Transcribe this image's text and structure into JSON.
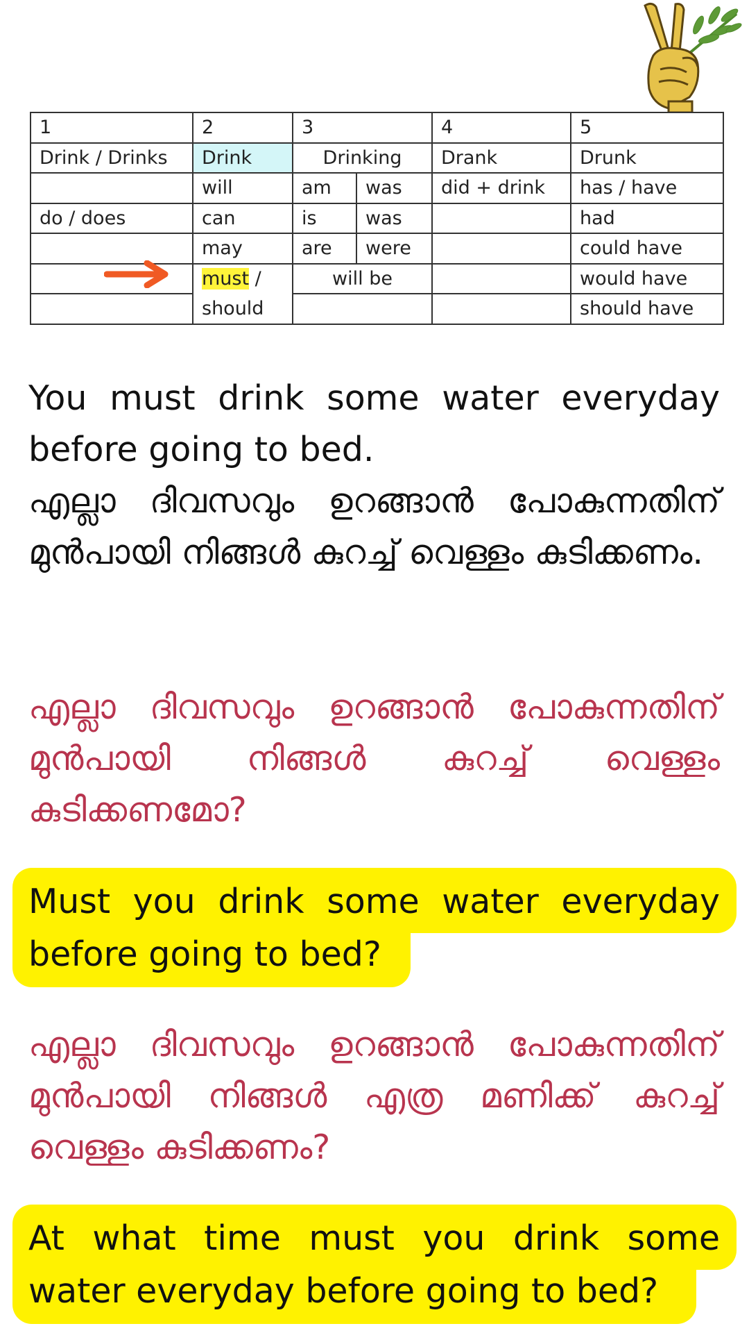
{
  "logo": {
    "icon": "victory-hand-olive-branch-icon",
    "colors": {
      "hand": "#e6c24a",
      "leaves": "#4f8a2c"
    }
  },
  "table": {
    "headers": [
      "1",
      "2",
      "3",
      "",
      "4",
      "5"
    ],
    "rows": [
      [
        "Drink / Drinks",
        "Drink",
        "Drinking",
        "Drank",
        "Drunk"
      ],
      [
        "",
        "will",
        "am",
        "was",
        "did + drink",
        "has / have"
      ],
      [
        "do / does",
        "can",
        "is",
        "was",
        "",
        "had"
      ],
      [
        "",
        "may",
        "are",
        "were",
        "",
        "could have"
      ],
      [
        "",
        "must",
        "/",
        "will be",
        "",
        "would have"
      ],
      [
        "",
        "should",
        "",
        "",
        "should have"
      ]
    ]
  },
  "arrow": {
    "icon": "right-arrow-icon",
    "color": "#f05a24"
  },
  "sentences": {
    "s1_en": "You must drink some water everyday before going to bed.",
    "s1_ml": "എല്ലാ ദിവസവും ഉറങ്ങാൻ പോകുന്നതിന് മുൻപായി നിങ്ങൾ കുറച്ച് വെള്ളം കുടിക്കണം.",
    "s2_ml": "എല്ലാ ദിവസവും ഉറങ്ങാൻ പോകുന്നതിന് മുൻപായി നിങ്ങൾ കുറച്ച് വെള്ളം കുടിക്കണമോ?",
    "s2_en_line1": "Must you drink some water everyday",
    "s2_en_line2": "before going to bed?",
    "s3_ml": "എല്ലാ ദിവസവും ഉറങ്ങാൻ പോകുന്നതിന് മുൻപായി നിങ്ങൾ എത്ര മണിക്ക് കുറച്ച് വെള്ളം കുടിക്കണം?",
    "s3_en_line1": "At what time must you drink some",
    "s3_en_line2": "water everyday before going to bed?"
  },
  "colors": {
    "malayalam_question": "#b8344e",
    "highlight": "#fff200",
    "header_cell": "#d4f6f8"
  }
}
